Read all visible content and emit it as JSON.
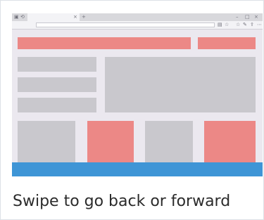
{
  "caption": "Swipe to go back or forward",
  "browser": {
    "tab_close_glyph": "×",
    "new_tab_glyph": "+",
    "window_controls": [
      "–",
      "□",
      "×"
    ],
    "toolbar_icons": [
      "reading-view-icon",
      "favorite-star-icon",
      "favorites-hub-icon",
      "pen-icon",
      "share-icon",
      "more-icon"
    ]
  },
  "colors": {
    "placeholder_gray": "#c9c8cd",
    "placeholder_red": "#ec8886",
    "accent_blue": "#3e95d6",
    "background": "#ebe8ef"
  }
}
